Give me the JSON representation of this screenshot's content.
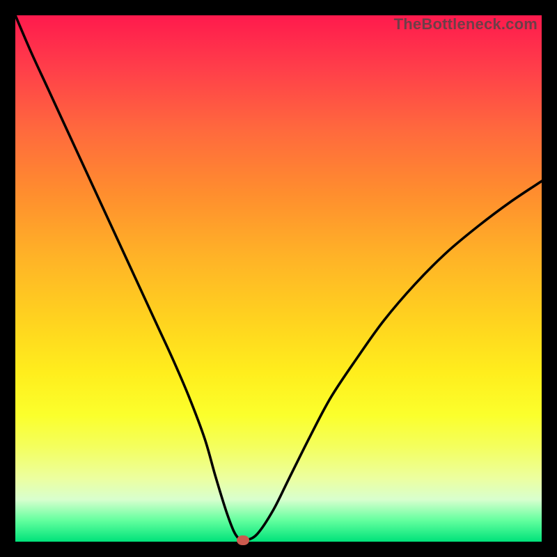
{
  "watermark": "TheBottleneck.com",
  "colors": {
    "frame": "#000000",
    "curve": "#000000",
    "marker": "#cc5a4e"
  },
  "chart_data": {
    "type": "line",
    "title": "",
    "xlabel": "",
    "ylabel": "",
    "xlim": [
      0,
      100
    ],
    "ylim": [
      0,
      100
    ],
    "grid": false,
    "series": [
      {
        "name": "bottleneck-curve",
        "x": [
          0,
          3,
          6,
          9,
          12,
          15,
          18,
          21,
          24,
          27,
          30,
          33,
          36,
          38,
          40,
          41.5,
          42.5,
          43,
          44,
          46,
          49,
          52,
          56,
          60,
          65,
          70,
          76,
          82,
          88,
          94,
          100
        ],
        "y": [
          100,
          93,
          86.5,
          80,
          73.5,
          67,
          60.5,
          54,
          47.5,
          41,
          34.5,
          27.5,
          19.5,
          12.5,
          6,
          2,
          0.5,
          0.3,
          0.3,
          1.5,
          6,
          12,
          20,
          27.5,
          35,
          42,
          49,
          55,
          60,
          64.5,
          68.5
        ]
      }
    ],
    "marker": {
      "x": 43.3,
      "y": 0.2
    },
    "background_gradient": {
      "top": "#ff1a4d",
      "mid": "#ffd31f",
      "bottom": "#00e27a"
    }
  }
}
